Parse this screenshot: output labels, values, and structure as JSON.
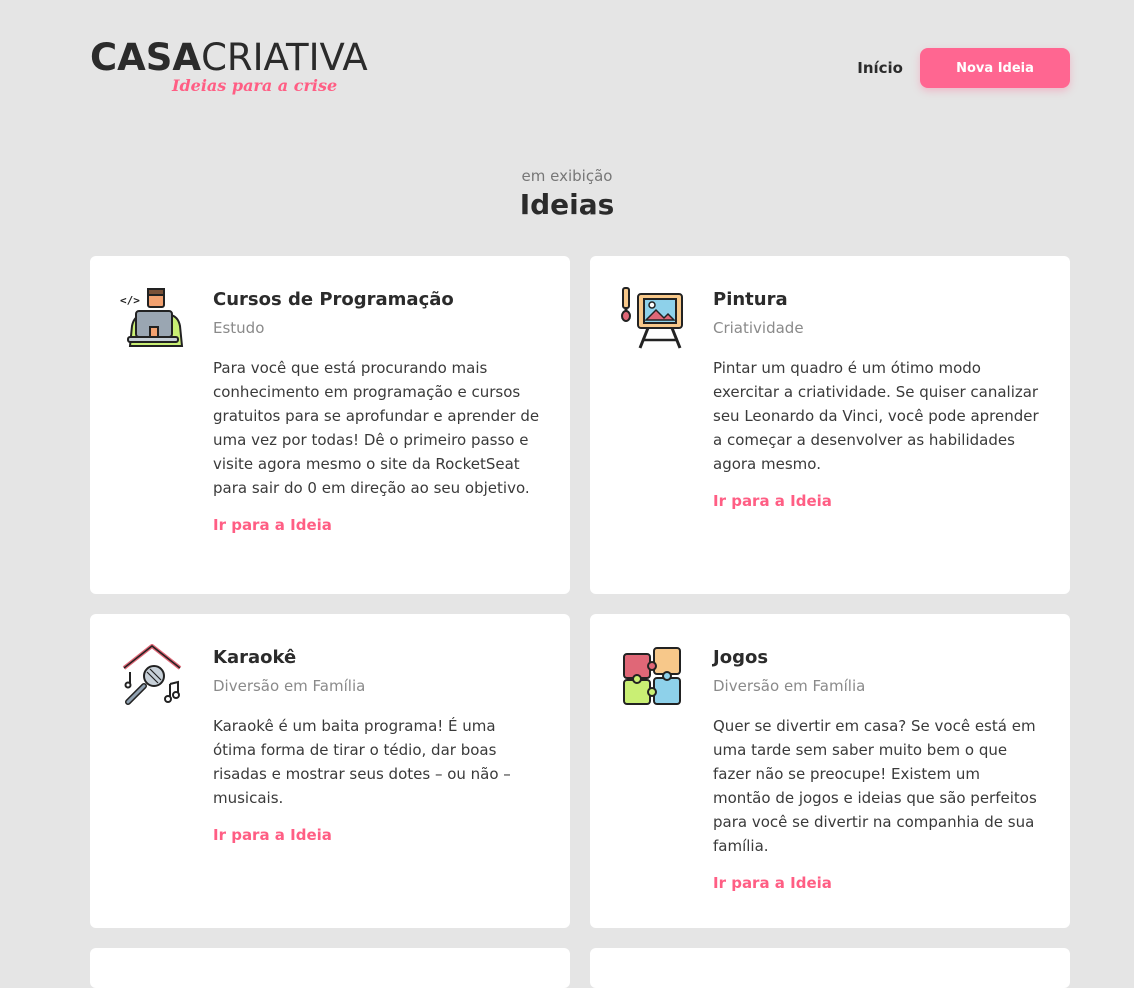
{
  "header": {
    "logo_bold": "CASA",
    "logo_light": "CRIATIVA",
    "logo_tagline": "Ideias para a crise",
    "nav_home": "Início",
    "nav_new_idea": "Nova Ideia"
  },
  "section": {
    "subtitle": "em exibição",
    "title": "Ideias"
  },
  "colors": {
    "accent": "#ff6691",
    "background": "#e5e5e5",
    "card": "#ffffff"
  },
  "ideas": [
    {
      "icon": "programmer-laptop-icon",
      "title": "Cursos de Programação",
      "category": "Estudo",
      "description": "Para você que está procurando mais conhecimento em programação e cursos gratuitos para se aprofundar e aprender de uma vez por todas! Dê o primeiro passo e visite agora mesmo o site da RocketSeat para sair do 0 em direção ao seu objetivo.",
      "link": "Ir para a Ideia"
    },
    {
      "icon": "painting-easel-icon",
      "title": "Pintura",
      "category": "Criatividade",
      "description": "Pintar um quadro é um ótimo modo exercitar a criatividade. Se quiser canalizar seu Leonardo da Vinci, você pode aprender a começar a desenvolver as habilidades agora mesmo.",
      "link": "Ir para a Ideia"
    },
    {
      "icon": "karaoke-microphone-icon",
      "title": "Karaokê",
      "category": "Diversão em Família",
      "description": "Karaokê é um baita programa! É uma ótima forma de tirar o tédio, dar boas risadas e mostrar seus dotes – ou não – musicais.",
      "link": "Ir para a Ideia"
    },
    {
      "icon": "puzzle-pieces-icon",
      "title": "Jogos",
      "category": "Diversão em Família",
      "description": "Quer se divertir em casa? Se você está em uma tarde sem saber muito bem o que fazer não se preocupe! Existem um montão de jogos e ideias que são perfeitos para você se divertir na companhia de sua família.",
      "link": "Ir para a Ideia"
    }
  ]
}
